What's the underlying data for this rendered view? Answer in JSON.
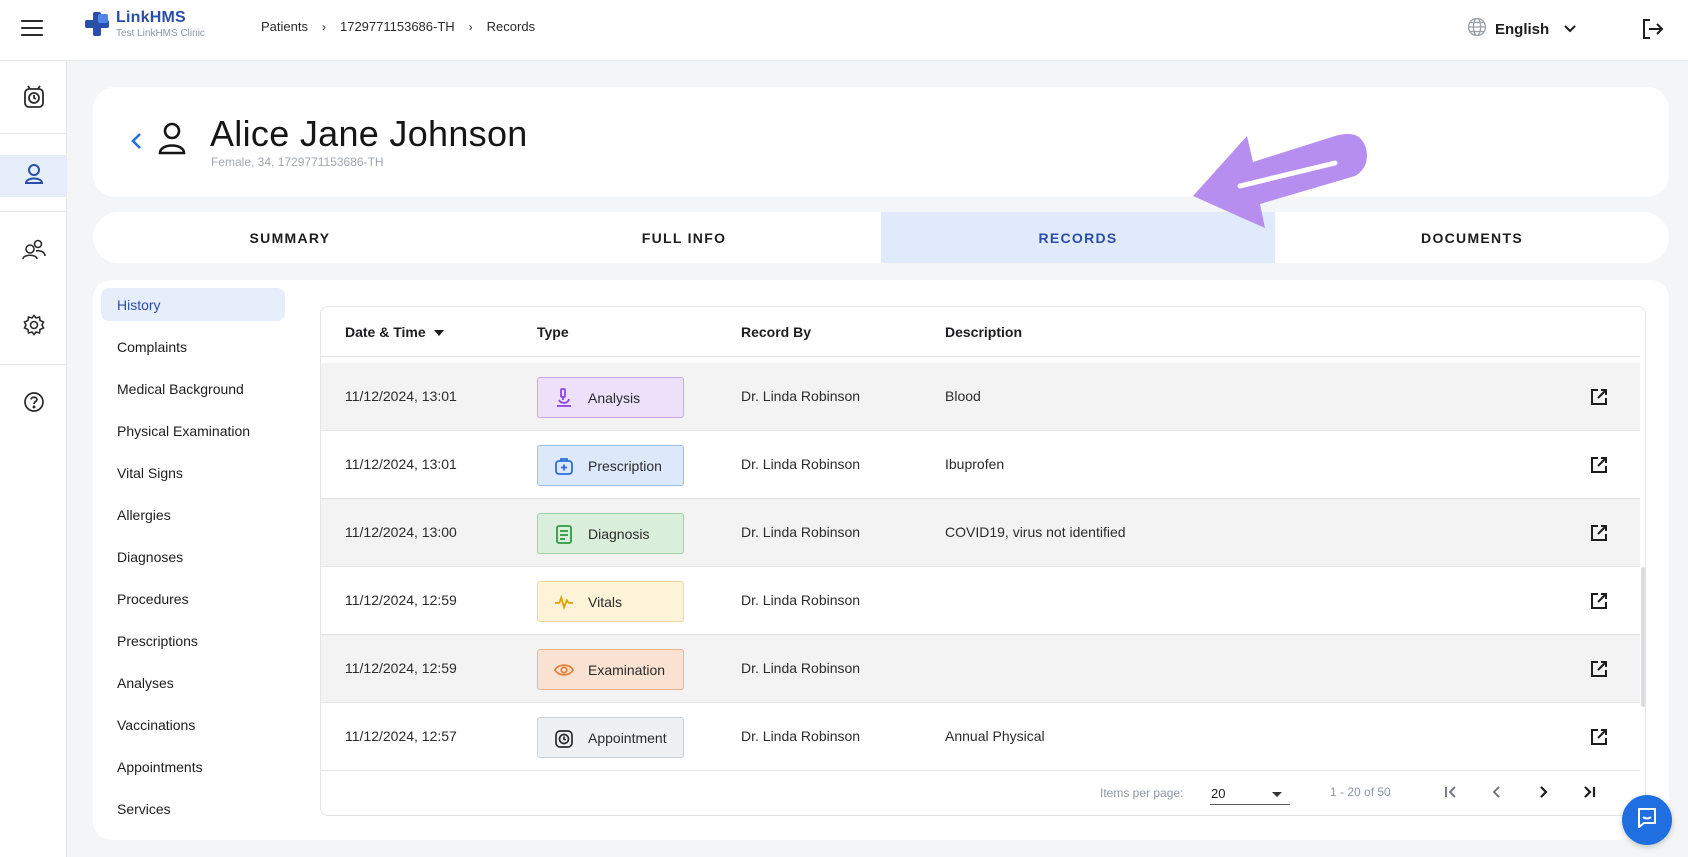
{
  "app": {
    "logo_title": "LinkHMS",
    "logo_subtitle": "Test LinkHMS Clinic",
    "brand_color": "#2a4fa8"
  },
  "breadcrumb": {
    "items": [
      "Patients",
      "1729771153686-TH",
      "Records"
    ]
  },
  "header": {
    "language": "English"
  },
  "patient": {
    "name": "Alice Jane Johnson",
    "details": "Female, 34, 1729771153686-TH"
  },
  "tabs": [
    {
      "label": "SUMMARY"
    },
    {
      "label": "FULL INFO"
    },
    {
      "label": "RECORDS"
    },
    {
      "label": "DOCUMENTS"
    }
  ],
  "subnav": {
    "items": [
      {
        "label": "History"
      },
      {
        "label": "Complaints"
      },
      {
        "label": "Medical Background"
      },
      {
        "label": "Physical Examination"
      },
      {
        "label": "Vital Signs"
      },
      {
        "label": "Allergies"
      },
      {
        "label": "Diagnoses"
      },
      {
        "label": "Procedures"
      },
      {
        "label": "Prescriptions"
      },
      {
        "label": "Analyses"
      },
      {
        "label": "Vaccinations"
      },
      {
        "label": "Appointments"
      },
      {
        "label": "Services"
      }
    ]
  },
  "table": {
    "columns": [
      "Date & Time",
      "Type",
      "Record By",
      "Description"
    ],
    "rows": [
      {
        "datetime": "11/12/2024, 13:01",
        "type": "Analysis",
        "record_by": "Dr. Linda Robinson",
        "description": "Blood",
        "icon": "microscope-icon",
        "badge_bg": "#ece0fb",
        "badge_border": "#c9a8f2",
        "icon_color": "#8e44e6"
      },
      {
        "datetime": "11/12/2024, 13:01",
        "type": "Prescription",
        "record_by": "Dr. Linda Robinson",
        "description": "Ibuprofen",
        "icon": "medkit-icon",
        "badge_bg": "#dde8fb",
        "badge_border": "#9dbcf0",
        "icon_color": "#2a6fdc"
      },
      {
        "datetime": "11/12/2024, 13:00",
        "type": "Diagnosis",
        "record_by": "Dr. Linda Robinson",
        "description": "COVID19, virus not identified",
        "icon": "clipboard-icon",
        "badge_bg": "#d9eedb",
        "badge_border": "#9fd3a5",
        "icon_color": "#2e9a41"
      },
      {
        "datetime": "11/12/2024, 12:59",
        "type": "Vitals",
        "record_by": "Dr. Linda Robinson",
        "description": "",
        "icon": "pulse-icon",
        "badge_bg": "#fdf3d8",
        "badge_border": "#f2d992",
        "icon_color": "#e0a100"
      },
      {
        "datetime": "11/12/2024, 12:59",
        "type": "Examination",
        "record_by": "Dr. Linda Robinson",
        "description": "",
        "icon": "eye-icon",
        "badge_bg": "#fae2d2",
        "badge_border": "#efb48d",
        "icon_color": "#e8772e"
      },
      {
        "datetime": "11/12/2024, 12:57",
        "type": "Appointment",
        "record_by": "Dr. Linda Robinson",
        "description": "Annual Physical",
        "icon": "alarm-clock-icon",
        "badge_bg": "#edf1f4",
        "badge_border": "#c9d1d8",
        "icon_color": "#2b2b2b"
      }
    ]
  },
  "pagination": {
    "items_per_page_label": "Items per page:",
    "items_per_page": "20",
    "range": "1 - 20 of 50"
  },
  "annotation_color": "#b58ef0"
}
